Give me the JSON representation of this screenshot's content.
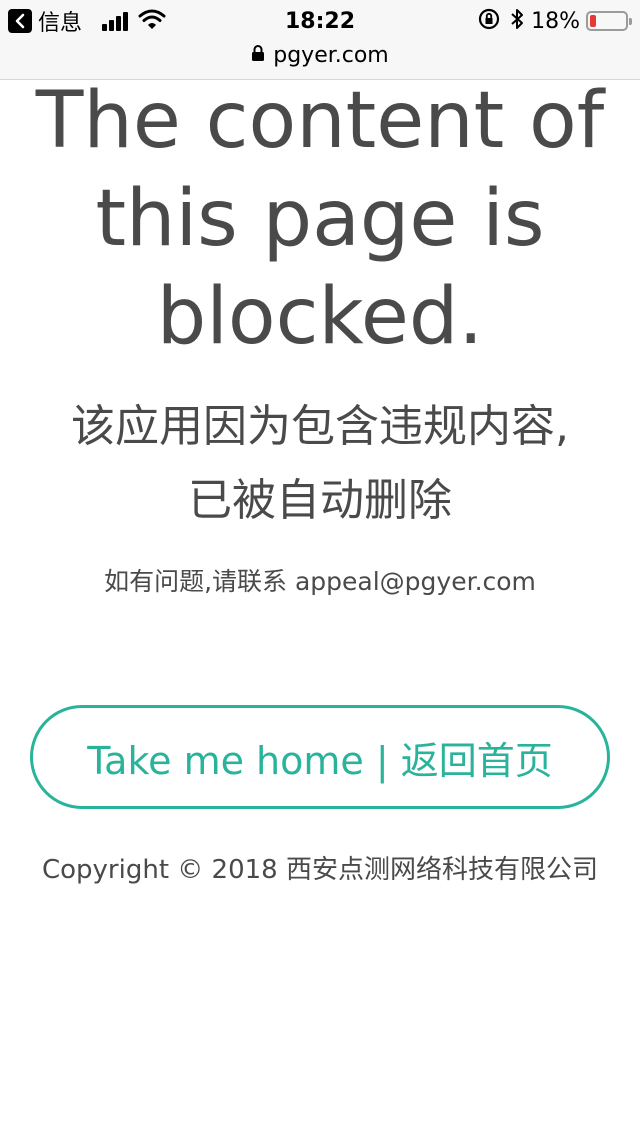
{
  "status_bar": {
    "back_app": "信息",
    "time": "18:22",
    "battery_percent": "18%",
    "battery_level": 0.18,
    "battery_color": "#e53935",
    "url": "pgyer.com"
  },
  "main": {
    "headline": "The content of this page is blocked.",
    "notice_cn_line1": "该应用因为包含违规内容,",
    "notice_cn_line2": "已被自动删除",
    "contact": "如有问题,请联系 appeal@pgyer.com",
    "home_button": "Take me home | 返回首页",
    "copyright": "Copyright © 2018 西安点测网络科技有限公司"
  },
  "colors": {
    "accent": "#2ab39b",
    "text": "#4a4a4a"
  }
}
